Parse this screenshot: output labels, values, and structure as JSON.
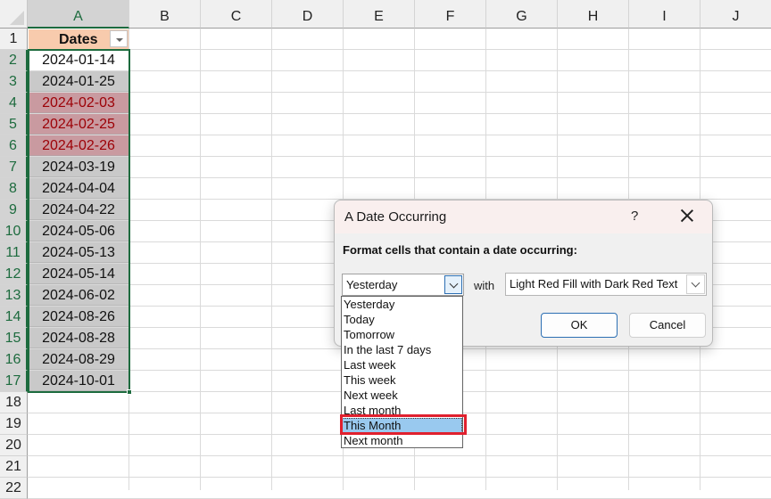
{
  "spreadsheet": {
    "columns": [
      "A",
      "B",
      "C",
      "D",
      "E",
      "F",
      "G",
      "H",
      "I",
      "J"
    ],
    "selected_column": "A",
    "rows": [
      "1",
      "2",
      "3",
      "4",
      "5",
      "6",
      "7",
      "8",
      "9",
      "10",
      "11",
      "12",
      "13",
      "14",
      "15",
      "16",
      "17",
      "18",
      "19",
      "20",
      "21",
      "22"
    ],
    "header_cell": "Dates",
    "dates": [
      {
        "value": "2024-01-14",
        "style": "white"
      },
      {
        "value": "2024-01-25",
        "style": "gray"
      },
      {
        "value": "2024-02-03",
        "style": "red"
      },
      {
        "value": "2024-02-25",
        "style": "red"
      },
      {
        "value": "2024-02-26",
        "style": "red"
      },
      {
        "value": "2024-03-19",
        "style": "gray"
      },
      {
        "value": "2024-04-04",
        "style": "gray"
      },
      {
        "value": "2024-04-22",
        "style": "gray"
      },
      {
        "value": "2024-05-06",
        "style": "gray"
      },
      {
        "value": "2024-05-13",
        "style": "gray"
      },
      {
        "value": "2024-05-14",
        "style": "gray"
      },
      {
        "value": "2024-06-02",
        "style": "gray"
      },
      {
        "value": "2024-08-26",
        "style": "gray"
      },
      {
        "value": "2024-08-28",
        "style": "gray"
      },
      {
        "value": "2024-08-29",
        "style": "gray"
      },
      {
        "value": "2024-10-01",
        "style": "gray"
      }
    ],
    "colors": {
      "header_fill": "#f8cbad",
      "highlight_fill": "#c99aa0",
      "highlight_text": "#9c0006",
      "selection_border": "#1d6b3e"
    }
  },
  "dialog": {
    "title": "A Date Occurring",
    "help": "?",
    "instruction": "Format cells that contain a date occurring:",
    "period_value": "Yesterday",
    "with_label": "with",
    "format_value": "Light Red Fill with Dark Red Text",
    "ok_label": "OK",
    "cancel_label": "Cancel",
    "dropdown_options": [
      "Yesterday",
      "Today",
      "Tomorrow",
      "In the last 7 days",
      "Last week",
      "This week",
      "Next week",
      "Last month",
      "This Month",
      "Next month"
    ],
    "hovered_option": "This Month",
    "annotation_color": "#e0202e"
  }
}
